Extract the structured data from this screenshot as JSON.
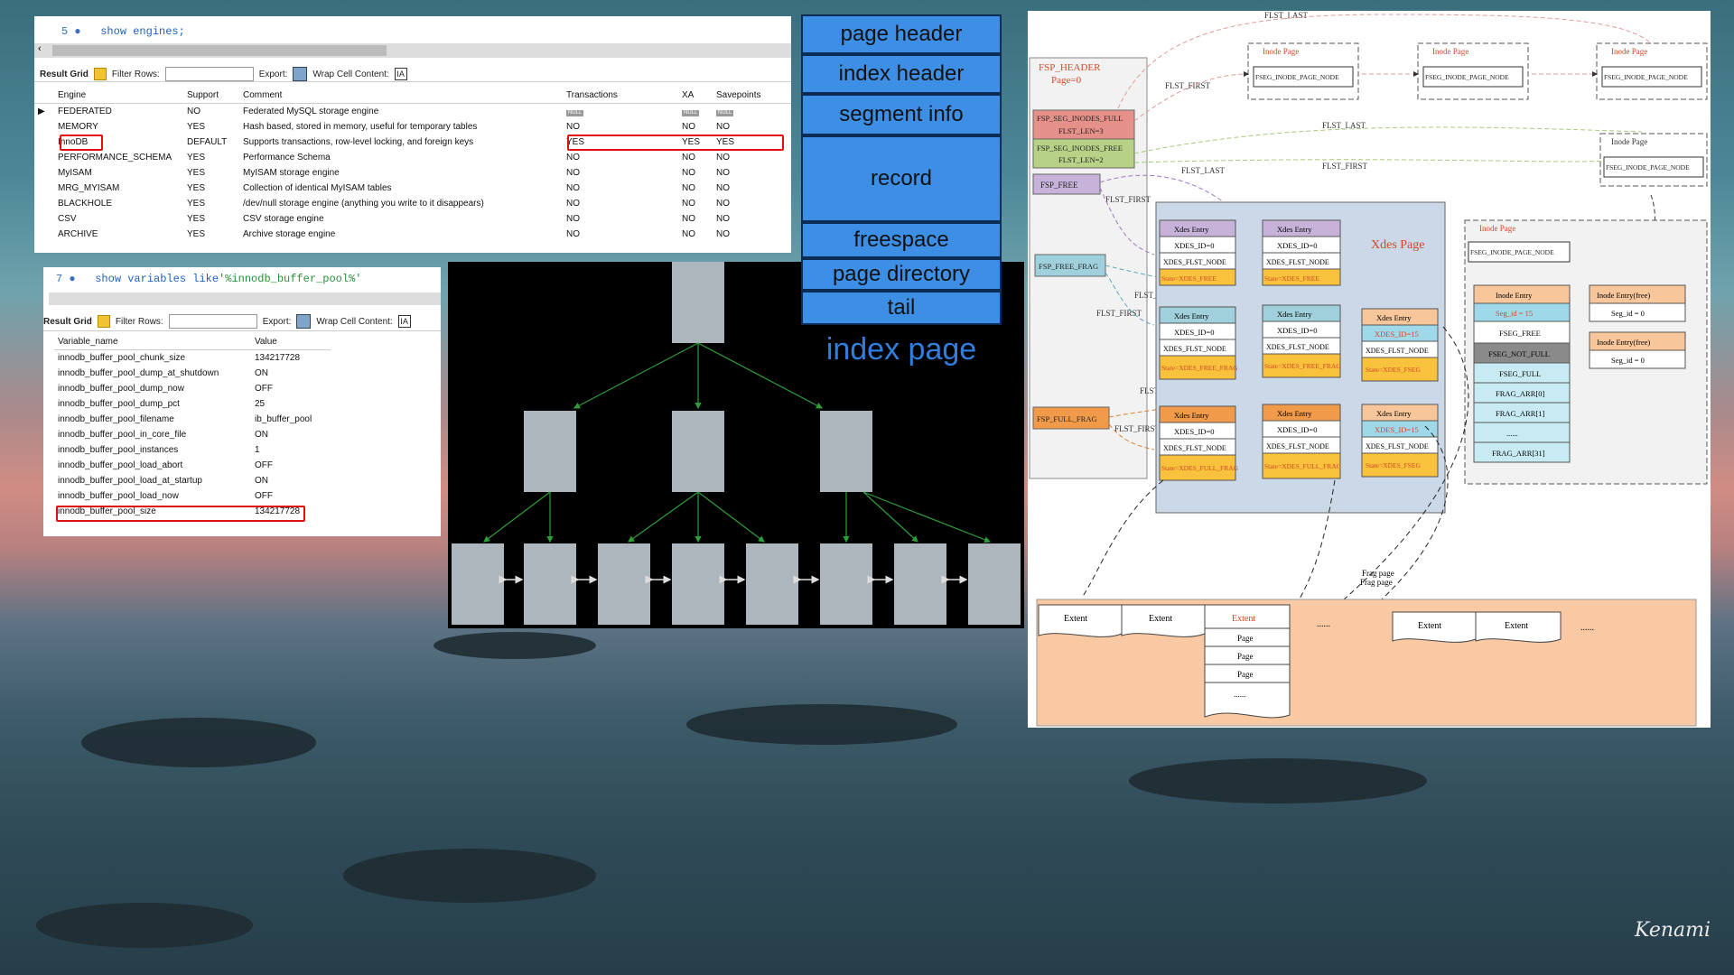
{
  "engines_query": {
    "line": "5",
    "sql": "show engines;"
  },
  "engines_toolbar": {
    "result_grid": "Result Grid",
    "filter_rows": "Filter Rows:",
    "export": "Export:",
    "wrap": "Wrap Cell Content:"
  },
  "engines_table": {
    "headers": [
      "Engine",
      "Support",
      "Comment",
      "Transactions",
      "XA",
      "Savepoints"
    ],
    "null_label": "NULL",
    "rows": [
      [
        "FEDERATED",
        "NO",
        "Federated MySQL storage engine",
        "",
        "",
        ""
      ],
      [
        "MEMORY",
        "YES",
        "Hash based, stored in memory, useful for temporary tables",
        "NO",
        "NO",
        "NO"
      ],
      [
        "InnoDB",
        "DEFAULT",
        "Supports transactions, row-level locking, and foreign keys",
        "YES",
        "YES",
        "YES"
      ],
      [
        "PERFORMANCE_SCHEMA",
        "YES",
        "Performance Schema",
        "NO",
        "NO",
        "NO"
      ],
      [
        "MyISAM",
        "YES",
        "MyISAM storage engine",
        "NO",
        "NO",
        "NO"
      ],
      [
        "MRG_MYISAM",
        "YES",
        "Collection of identical MyISAM tables",
        "NO",
        "NO",
        "NO"
      ],
      [
        "BLACKHOLE",
        "YES",
        "/dev/null storage engine (anything you write to it disappears)",
        "NO",
        "NO",
        "NO"
      ],
      [
        "CSV",
        "YES",
        "CSV storage engine",
        "NO",
        "NO",
        "NO"
      ],
      [
        "ARCHIVE",
        "YES",
        "Archive storage engine",
        "NO",
        "NO",
        "NO"
      ]
    ]
  },
  "vars_query": {
    "line": "7",
    "sql_kw": "show  variables like",
    "sql_str": "'%innodb_buffer_pool%'"
  },
  "vars_toolbar": {
    "result_grid": "Result Grid",
    "filter_rows": "Filter Rows:",
    "export": "Export:",
    "wrap": "Wrap Cell Content:"
  },
  "vars_table": {
    "headers": [
      "Variable_name",
      "Value"
    ],
    "rows": [
      [
        "innodb_buffer_pool_chunk_size",
        "134217728"
      ],
      [
        "innodb_buffer_pool_dump_at_shutdown",
        "ON"
      ],
      [
        "innodb_buffer_pool_dump_now",
        "OFF"
      ],
      [
        "innodb_buffer_pool_dump_pct",
        "25"
      ],
      [
        "innodb_buffer_pool_filename",
        "ib_buffer_pool"
      ],
      [
        "innodb_buffer_pool_in_core_file",
        "ON"
      ],
      [
        "innodb_buffer_pool_instances",
        "1"
      ],
      [
        "innodb_buffer_pool_load_abort",
        "OFF"
      ],
      [
        "innodb_buffer_pool_load_at_startup",
        "ON"
      ],
      [
        "innodb_buffer_pool_load_now",
        "OFF"
      ],
      [
        "innodb_buffer_pool_size",
        "134217728"
      ]
    ]
  },
  "index_page": {
    "sections": [
      "page header",
      "index header",
      "segment info",
      "record",
      "freespace",
      "page directory",
      "tail"
    ],
    "caption": "index page"
  },
  "space_diagram": {
    "fsp_header": "FSP_HEADER",
    "page0": "Page=0",
    "seg_inodes_full": "FSP_SEG_INODES_FULL",
    "flst_len3": "FLST_LEN=3",
    "seg_inodes_free": "FSP_SEG_INODES_FREE",
    "flst_len2": "FLST_LEN=2",
    "fsp_free": "FSP_FREE",
    "fsp_free_frag": "FSP_FREE_FRAG",
    "fsp_full_frag": "FSP_FULL_FRAG",
    "inode_page": "Inode Page",
    "fseg_inode_page_node": "FSEG_INODE_PAGE_NODE",
    "flst_last": "FLST_LAST",
    "flst_first": "FLST_FIRST",
    "xdes_page": "Xdes Page",
    "xdes_entry": "Xdes Entry",
    "xdes_id0": "XDES_ID=0",
    "xdes_id15": "XDES_ID=15",
    "xdes_flst_node": "XDES_FLST_NODE",
    "state_free": "State=XDES_FREE",
    "state_free_frag": "State=XDES_FREE_FRAG",
    "state_full_frag": "State=XDES_FULL_FRAG",
    "state_fseg": "State=XDES_FSEG",
    "inode_entry": "Inode Entry",
    "seg_id15": "Seg_id = 15",
    "fseg_free": "FSEG_FREE",
    "fseg_not_full": "FSEG_NOT_FULL",
    "fseg_full": "FSEG_FULL",
    "frag_arr0": "FRAG_ARR[0]",
    "frag_arr1": "FRAG_ARR[1]",
    "dots": "......",
    "frag_arr31": "FRAG_ARR[31]",
    "inode_entry_free": "Inode Entry(free)",
    "seg_id0": "Seg_id = 0",
    "extent": "Extent",
    "page": "Page",
    "frag_page": "Frag page"
  },
  "signature": "Kenami"
}
